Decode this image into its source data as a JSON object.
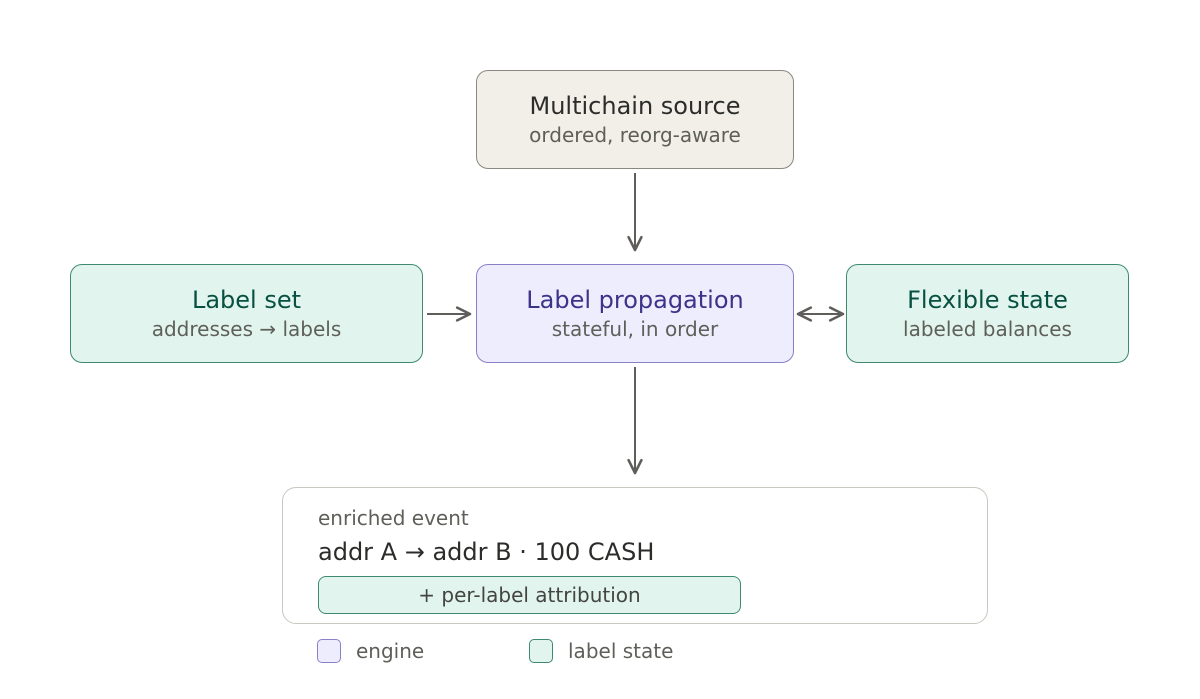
{
  "nodes": {
    "source": {
      "title": "Multichain source",
      "subtitle": "ordered, reorg-aware"
    },
    "engine": {
      "title": "Label propagation",
      "subtitle": "stateful, in order"
    },
    "label_set": {
      "title": "Label set",
      "subtitle": "addresses → labels"
    },
    "flexible_state": {
      "title": "Flexible state",
      "subtitle": "labeled balances"
    }
  },
  "edges": [
    {
      "from": "source",
      "to": "engine",
      "direction": "forward"
    },
    {
      "from": "label_set",
      "to": "engine",
      "direction": "forward"
    },
    {
      "from": "engine",
      "to": "flexible_state",
      "direction": "bidirectional"
    },
    {
      "from": "engine",
      "to": "output",
      "direction": "forward"
    }
  ],
  "output": {
    "caption": "enriched event",
    "event": "addr A → addr B · 100 CASH",
    "attribution": "+ per-label attribution"
  },
  "legend": {
    "engine": "engine",
    "label_state": "label state"
  },
  "colors": {
    "engine_fill": "#eeedfe",
    "engine_stroke": "#8a80c8",
    "label_state_fill": "#e1f5ee",
    "label_state_stroke": "#3f8a6c",
    "source_fill": "#f1efe8",
    "arrow": "#5f5e5a"
  }
}
